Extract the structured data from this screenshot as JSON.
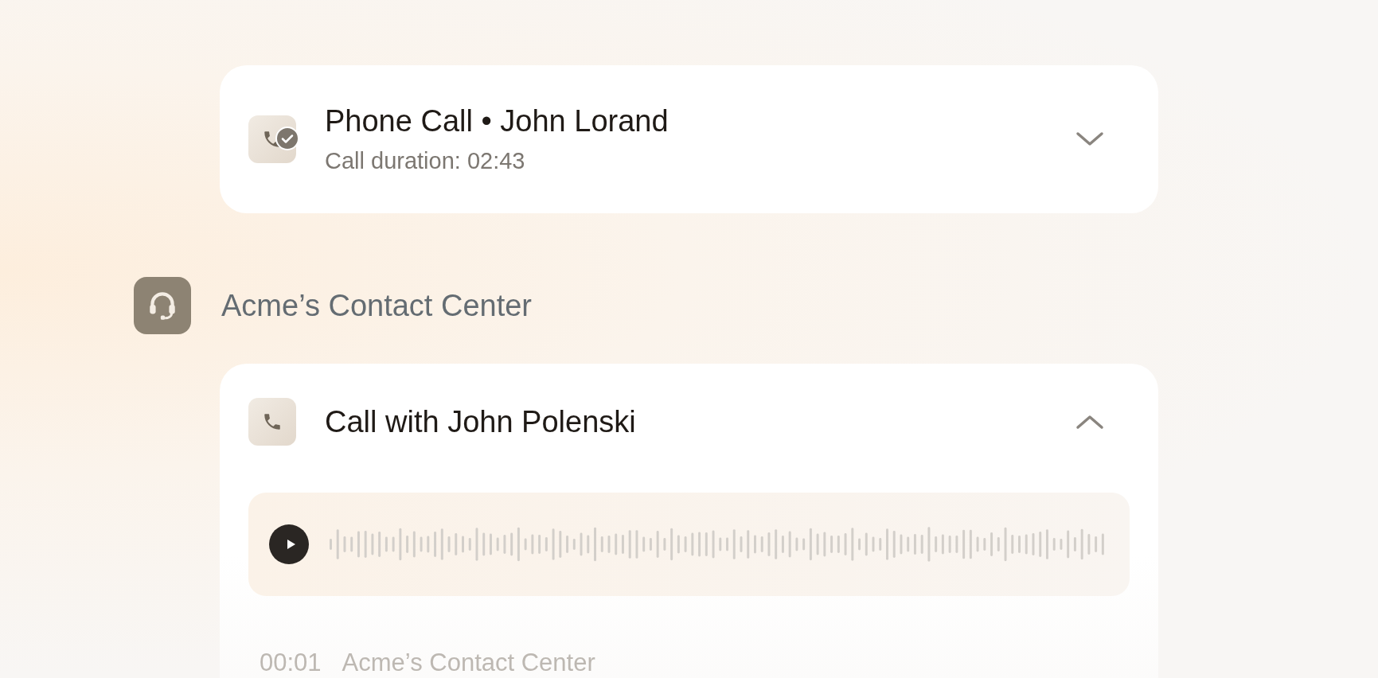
{
  "timeline": [
    {
      "kind": "call_card",
      "title": "Phone Call • John Lorand",
      "subtitle": "Call duration: 02:43",
      "completed": true,
      "expanded": false
    },
    {
      "kind": "agent_header",
      "name": "Acme’s Contact Center"
    },
    {
      "kind": "call_card",
      "title": "Call with John Polenski",
      "completed": false,
      "expanded": true,
      "player": {
        "playing": false
      },
      "transcript": [
        {
          "time": "00:01",
          "speaker": "Acme’s Contact Center"
        }
      ]
    }
  ]
}
